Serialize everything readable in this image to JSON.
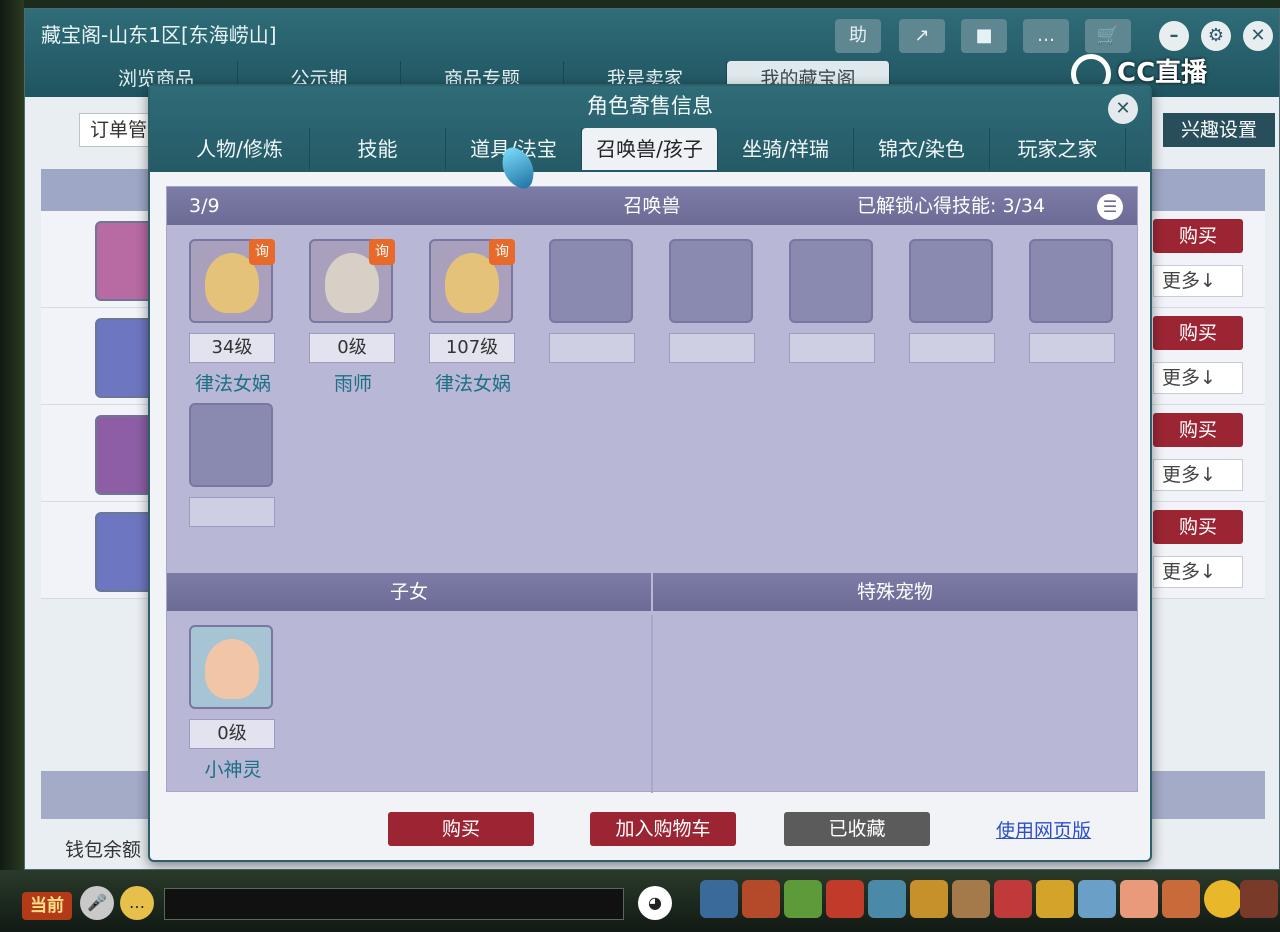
{
  "outer_window": {
    "title": "藏宝阁-山东1区[东海崂山]",
    "tools": [
      "助",
      "↗",
      "■",
      "…",
      "🛒"
    ],
    "controls": [
      "–",
      "⚙",
      "✕"
    ],
    "tabs": [
      "浏览商品",
      "公示期",
      "商品专题",
      "我是卖家",
      "我的藏宝阁"
    ],
    "active_tab": 4,
    "brand": "CC直播",
    "left_button": "订单管",
    "right_button": "兴趣设置",
    "row_buy_label": "购买",
    "row_more_label": "更多↓",
    "wallet_label": "钱包余额"
  },
  "modal": {
    "title": "角色寄售信息",
    "close_icon": "close-icon",
    "tabs": [
      "人物/修炼",
      "技能",
      "道具/法宝",
      "召唤兽/孩子",
      "坐骑/祥瑞",
      "锦衣/染色",
      "玩家之家"
    ],
    "active_tab": 3,
    "summon": {
      "count": "3/9",
      "heading": "召唤兽",
      "skills_label": "已解锁心得技能: 3/34",
      "ask_badge": "询",
      "pets": [
        {
          "level": "34级",
          "name": "律法女娲",
          "face": "#e5c27a"
        },
        {
          "level": "0级",
          "name": "雨师",
          "face": "#d6d0c6"
        },
        {
          "level": "107级",
          "name": "律法女娲",
          "face": "#e5c27a"
        },
        {
          "level": "",
          "name": ""
        },
        {
          "level": "",
          "name": ""
        },
        {
          "level": "",
          "name": ""
        },
        {
          "level": "",
          "name": ""
        },
        {
          "level": "",
          "name": ""
        },
        {
          "level": "",
          "name": ""
        }
      ]
    },
    "children": {
      "heading": "子女",
      "items": [
        {
          "level": "0级",
          "name": "小神灵"
        }
      ]
    },
    "special_pets": {
      "heading": "特殊宠物"
    },
    "buttons": {
      "buy": "购买",
      "add_cart": "加入购物车",
      "favorited": "已收藏",
      "web_version": "使用网页版"
    }
  },
  "game_bar": {
    "now_label": "当前"
  },
  "colors": {
    "accent_teal": "#2f6c78",
    "buy_red": "#9c2534",
    "panel_purple": "#b8b7d6",
    "link_blue": "#2c4fc8"
  }
}
